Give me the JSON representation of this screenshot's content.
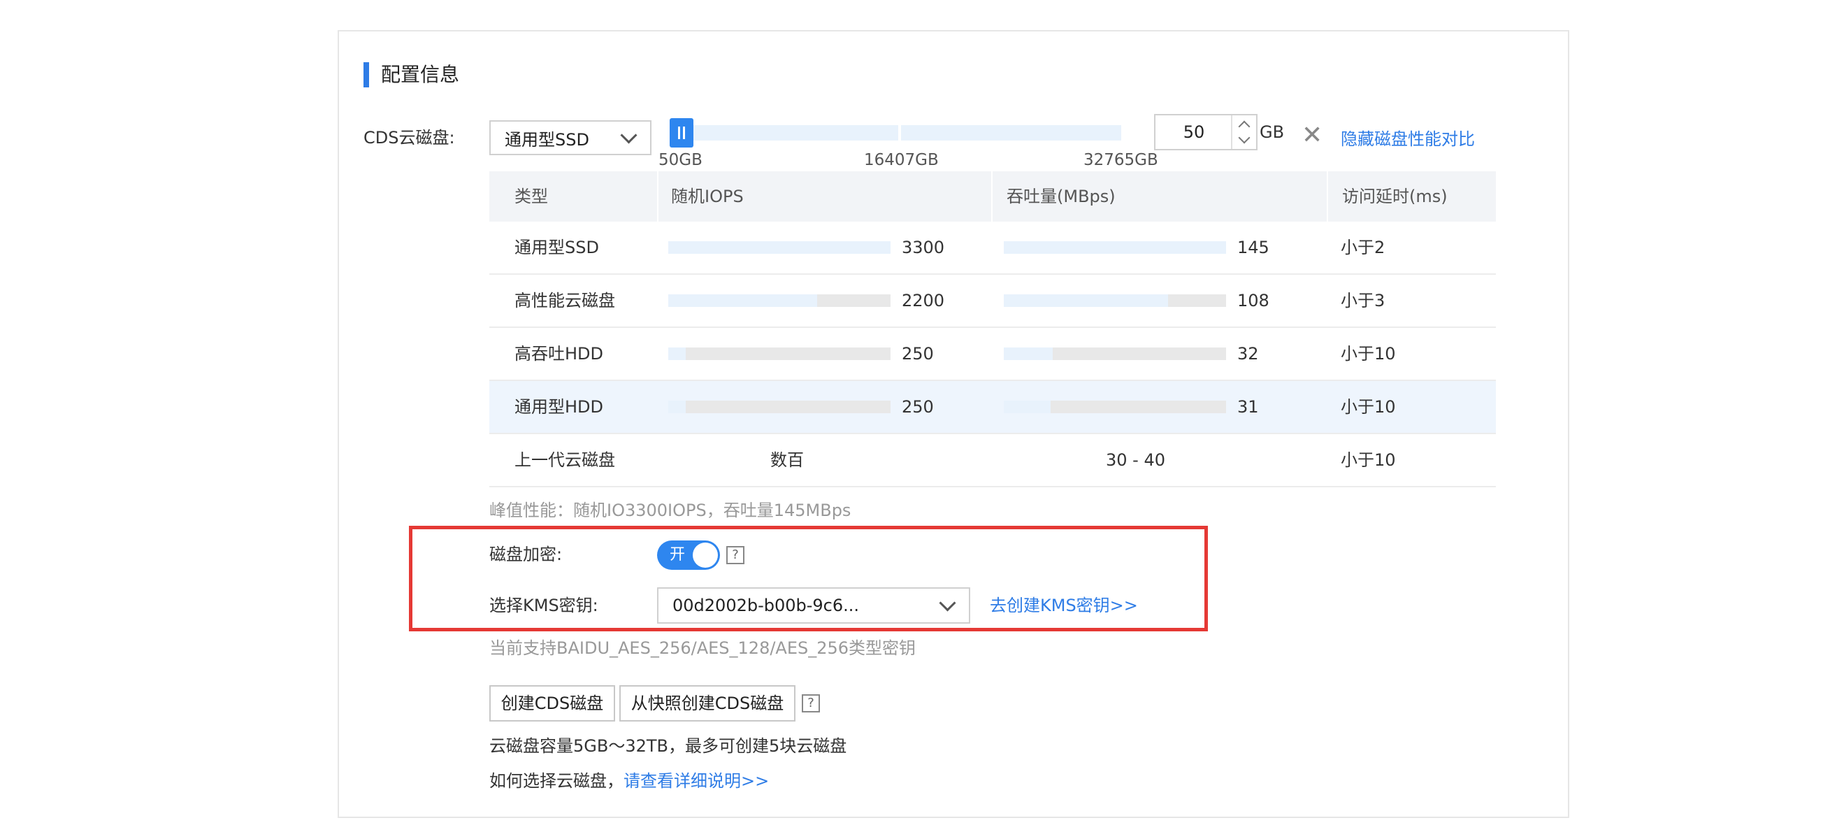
{
  "section_title": "配置信息",
  "cds": {
    "label": "CDS云磁盘:",
    "disk_type_selected": "通用型SSD",
    "slider": {
      "value_gb": 50,
      "min_label": "50GB",
      "mid_label": "16407GB",
      "max_label": "32765GB"
    },
    "size_value": "50",
    "size_unit": "GB",
    "hide_compare_link": "隐藏磁盘性能对比"
  },
  "perf_table": {
    "headers": [
      "类型",
      "随机IOPS",
      "吞吐量(MBps)",
      "访问延时(ms)"
    ],
    "rows": [
      {
        "type": "通用型SSD",
        "iops": "3300",
        "iops_fill": 1.0,
        "throughput": "145",
        "tp_fill": 1.0,
        "latency": "小于2",
        "highlighted": false
      },
      {
        "type": "高性能云磁盘",
        "iops": "2200",
        "iops_fill": 0.67,
        "throughput": "108",
        "tp_fill": 0.74,
        "latency": "小于3",
        "highlighted": false
      },
      {
        "type": "高吞吐HDD",
        "iops": "250",
        "iops_fill": 0.08,
        "throughput": "32",
        "tp_fill": 0.22,
        "latency": "小于10",
        "highlighted": false
      },
      {
        "type": "通用型HDD",
        "iops": "250",
        "iops_fill": 0.08,
        "throughput": "31",
        "tp_fill": 0.21,
        "latency": "小于10",
        "highlighted": true
      },
      {
        "type": "上一代云磁盘",
        "iops": "数百",
        "throughput": "30 - 40",
        "latency": "小于10",
        "highlighted": false
      }
    ]
  },
  "peak_note": "峰值性能：随机IO3300IOPS，吞吐量145MBps",
  "encryption": {
    "label": "磁盘加密:",
    "toggle_text": "开",
    "help": "?",
    "kms_label": "选择KMS密钥:",
    "kms_selected": "00d2002b-b00b-9c6...",
    "create_kms_link": "去创建KMS密钥>>"
  },
  "support_note": "当前支持BAIDU_AES_256/AES_128/AES_256类型密钥",
  "buttons": {
    "create_cds": "创建CDS磁盘",
    "create_from_snapshot": "从快照创建CDS磁盘",
    "help": "?"
  },
  "capacity_note": "云磁盘容量5GB～32TB，最多可创建5块云磁盘",
  "howto": {
    "text": "如何选择云磁盘，",
    "link": "请查看详细说明>>"
  },
  "colors": {
    "accent": "#2e7ce6",
    "highlight_box": "#e53935"
  }
}
